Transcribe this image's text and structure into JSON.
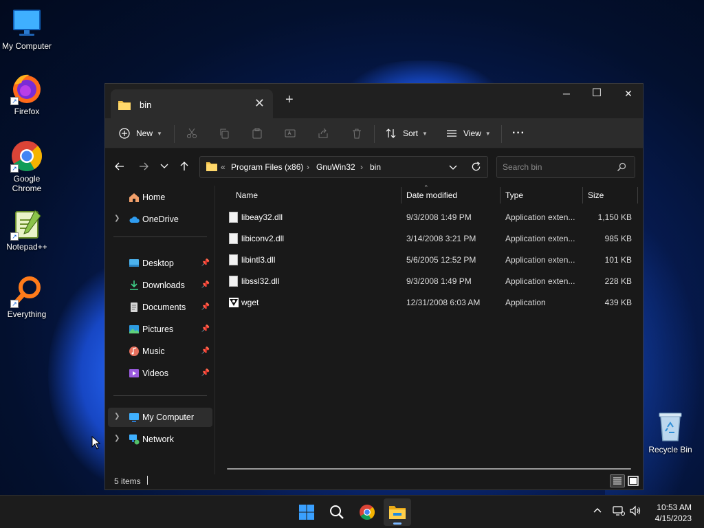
{
  "desktop": {
    "icons": [
      {
        "label": "My Computer"
      },
      {
        "label": "Firefox"
      },
      {
        "label": "Google Chrome"
      },
      {
        "label": "Notepad++"
      },
      {
        "label": "Everything"
      },
      {
        "label": "Recycle Bin"
      }
    ]
  },
  "window": {
    "tab_title": "bin",
    "close_tab_glyph": "✕",
    "new_tab_glyph": "+",
    "caption": {
      "minimize": "─",
      "maximize": "☐",
      "close": "✕"
    }
  },
  "commandbar": {
    "new_label": "New",
    "sort_label": "Sort",
    "view_label": "View",
    "more_glyph": "···"
  },
  "address": {
    "overflow": "«",
    "crumbs": [
      "Program Files (x86)",
      "GnuWin32",
      "bin"
    ],
    "search_placeholder": "Search bin"
  },
  "navpane": {
    "items": [
      {
        "label": "Home"
      },
      {
        "label": "OneDrive"
      },
      {
        "label": "Desktop"
      },
      {
        "label": "Downloads"
      },
      {
        "label": "Documents"
      },
      {
        "label": "Pictures"
      },
      {
        "label": "Music"
      },
      {
        "label": "Videos"
      },
      {
        "label": "My Computer"
      },
      {
        "label": "Network"
      }
    ]
  },
  "filelist": {
    "columns": [
      "Name",
      "Date modified",
      "Type",
      "Size"
    ],
    "rows": [
      {
        "name": "libeay32.dll",
        "date": "9/3/2008 1:49 PM",
        "type": "Application exten...",
        "size": "1,150 KB"
      },
      {
        "name": "libiconv2.dll",
        "date": "3/14/2008 3:21 PM",
        "type": "Application exten...",
        "size": "985 KB"
      },
      {
        "name": "libintl3.dll",
        "date": "5/6/2005 12:52 PM",
        "type": "Application exten...",
        "size": "101 KB"
      },
      {
        "name": "libssl32.dll",
        "date": "9/3/2008 1:49 PM",
        "type": "Application exten...",
        "size": "228 KB"
      },
      {
        "name": "wget",
        "date": "12/31/2008 6:03 AM",
        "type": "Application",
        "size": "439 KB"
      }
    ]
  },
  "status": {
    "items_count": "5 items"
  },
  "taskbar": {
    "time": "10:53 AM",
    "date": "4/15/2023"
  },
  "colors": {
    "accent": "#60cdff",
    "folder": "#f3c34c",
    "window_bg": "#191919"
  }
}
